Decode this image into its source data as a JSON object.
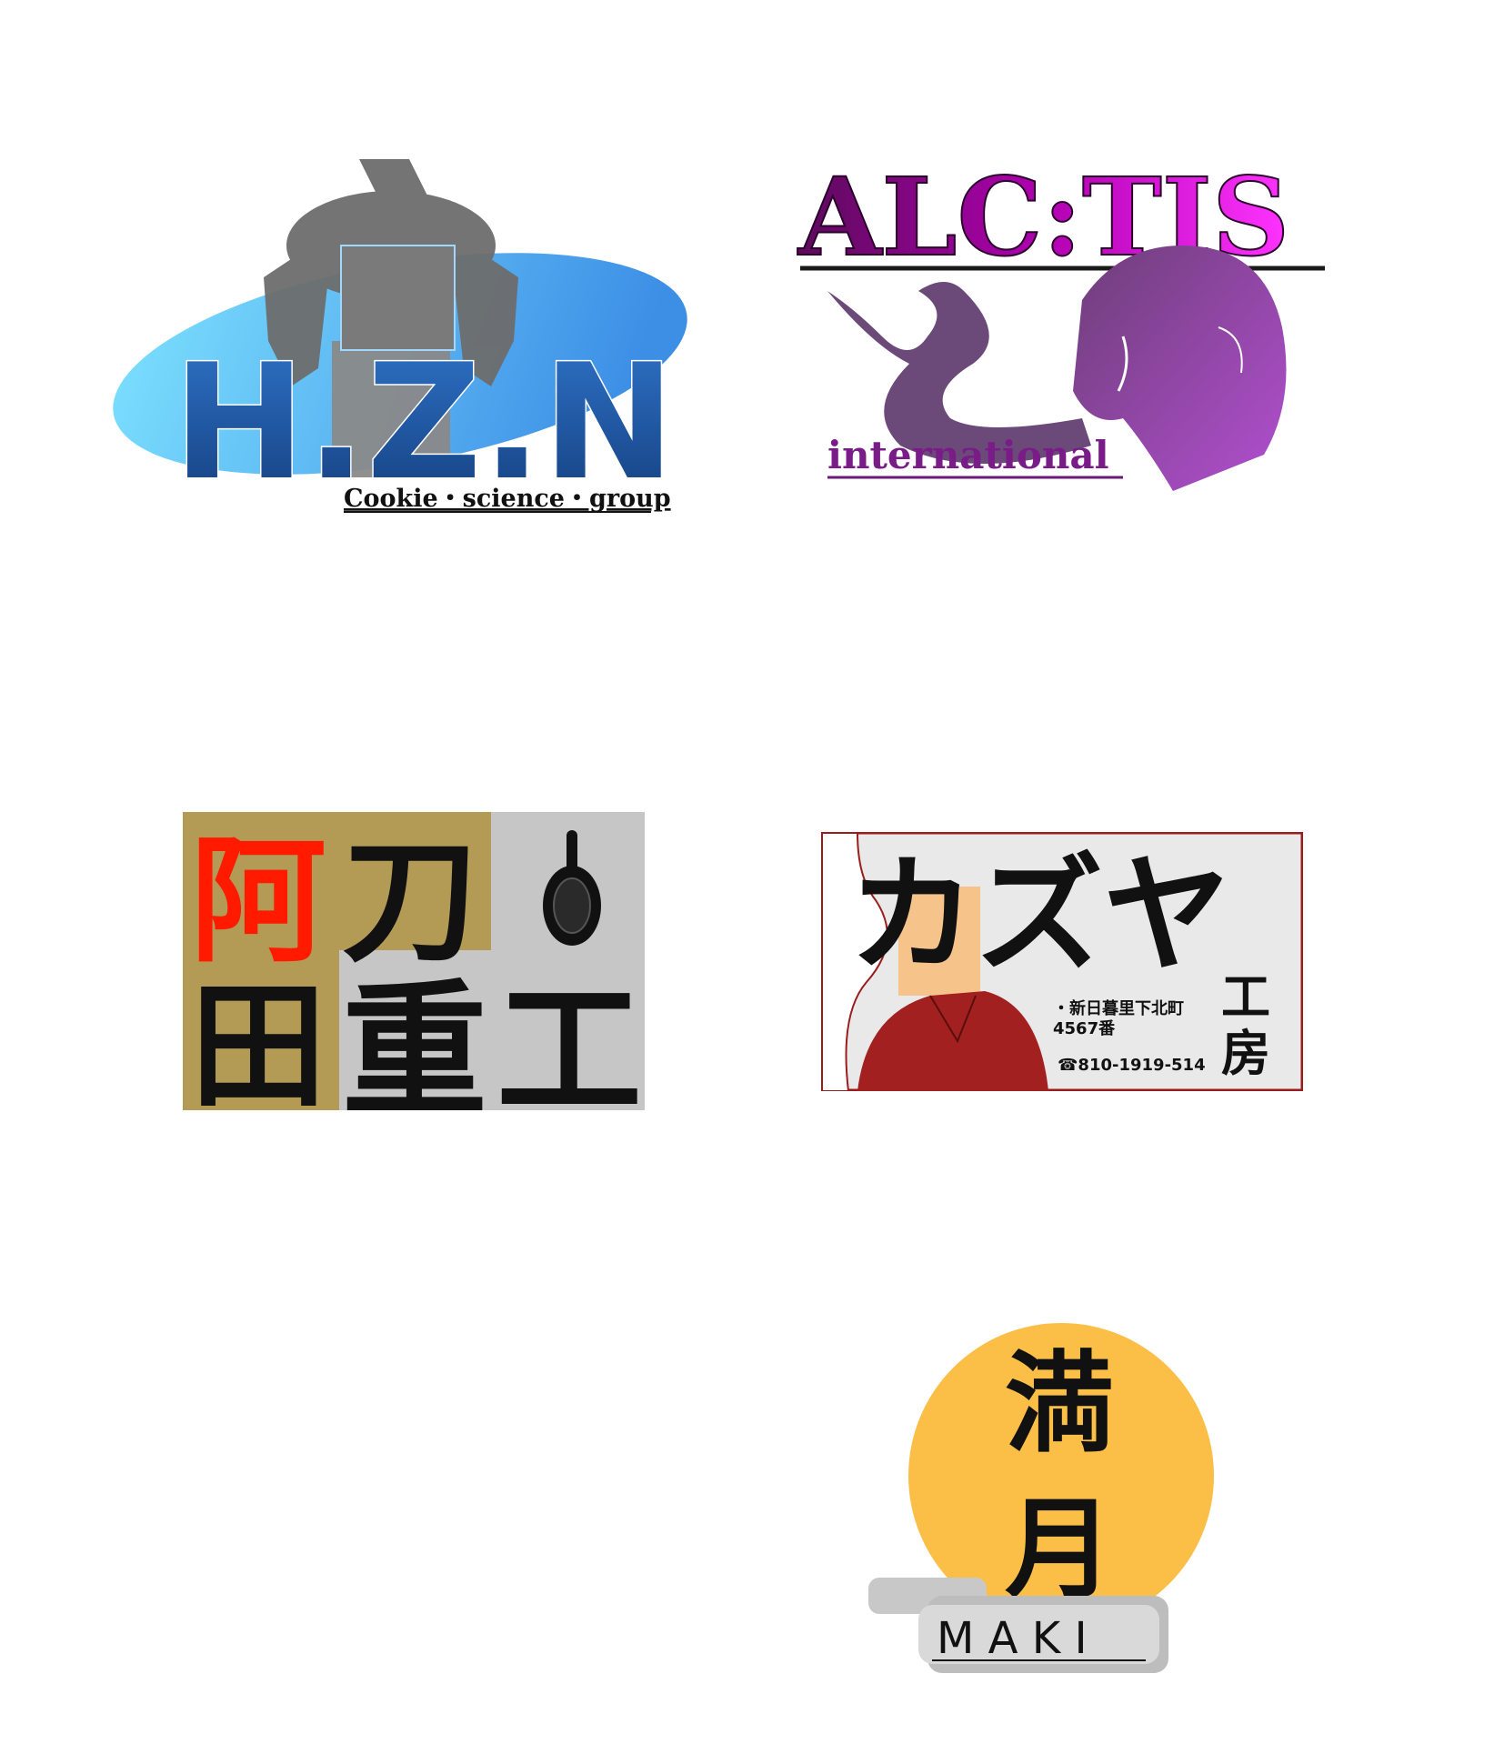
{
  "logos": {
    "hzn": {
      "title": "H.Z.N",
      "subtitle": "Cookie・science・group",
      "colors": {
        "ellipse": "#4ea9ef",
        "letters": "#1f4f9a",
        "figure": "#6b6b6b"
      }
    },
    "alctis": {
      "title": "ALC:TIS",
      "subtitle": "international",
      "colors": {
        "title_start": "#6e0070",
        "title_end": "#ff00ff",
        "figure": "#9a4fb4"
      }
    },
    "atoda": {
      "chars": [
        "阿",
        "刀",
        "田",
        "重",
        "工"
      ],
      "colors": {
        "gold": "#b39a55",
        "gray": "#c6c6c6",
        "red": "#ff1a00",
        "black": "#111111"
      }
    },
    "kazuya": {
      "title": "カズヤ",
      "subtitle_chars": [
        "工",
        "房"
      ],
      "address_line1": "・新日暮里下北町",
      "address_line2": "4567番",
      "phone": "☎810-1919-514",
      "colors": {
        "border": "#9b1c1c",
        "shirt": "#a32020",
        "skin": "#f6c48b"
      }
    },
    "mangetsu": {
      "chars": [
        "満",
        "月"
      ],
      "latin": "M A K I",
      "colors": {
        "moon": "#fbbe46"
      }
    }
  }
}
